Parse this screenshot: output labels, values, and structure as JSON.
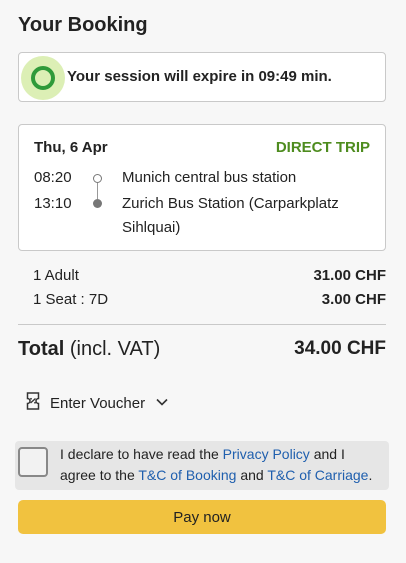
{
  "header": {
    "title": "Your Booking"
  },
  "session": {
    "prefix": "Your session will expire in",
    "time": "09:49",
    "suffix": "min."
  },
  "trip": {
    "date": "Thu, 6 Apr",
    "type": "DIRECT TRIP",
    "departure": {
      "time": "08:20",
      "station": "Munich central bus station"
    },
    "arrival": {
      "time": "13:10",
      "station": "Zurich Bus Station (Carparkplatz Sihlquai)"
    }
  },
  "prices": [
    {
      "label": "1 Adult",
      "value": "31.00 CHF"
    },
    {
      "label": "1 Seat : 7D",
      "value": "3.00 CHF"
    }
  ],
  "total": {
    "label": "Total",
    "note": "(incl. VAT)",
    "value": "34.00 CHF"
  },
  "voucher": {
    "label": "Enter Voucher"
  },
  "consent": {
    "text1": "I declare to have read the ",
    "link_privacy": "Privacy Policy",
    "text2": " and I agree to the ",
    "link_tc_booking": "T&C of Booking",
    "text3": " and ",
    "link_tc_carriage": "T&C of Carriage",
    "text4": "."
  },
  "pay": {
    "label": "Pay now"
  },
  "colors": {
    "accent_green": "#4e8c1f",
    "timer_green": "#2f9a3a",
    "pay_yellow": "#f1c23f",
    "link_blue": "#1f5fae"
  }
}
